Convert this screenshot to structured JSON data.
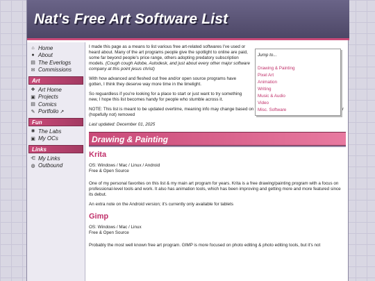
{
  "site": {
    "title": "Nat's Free Art Software List"
  },
  "sidebar": {
    "top": [
      {
        "icon": "⌂",
        "label": "Home"
      },
      {
        "icon": "●",
        "label": "About"
      },
      {
        "icon": "▤",
        "label": "The Everlogs"
      },
      {
        "icon": "✉",
        "label": "Commissions"
      }
    ],
    "art": {
      "heading": "Art",
      "items": [
        {
          "icon": "❖",
          "label": "Art Home"
        },
        {
          "icon": "▣",
          "label": "Projects"
        },
        {
          "icon": "▤",
          "label": "Comics"
        },
        {
          "icon": "✎",
          "label": "Portfolio",
          "ext": "↗"
        }
      ]
    },
    "fun": {
      "heading": "Fun",
      "items": [
        {
          "icon": "✺",
          "label": "The Labs"
        },
        {
          "icon": "▣",
          "label": "My OCs"
        }
      ]
    },
    "links": {
      "heading": "Links",
      "items": [
        {
          "icon": "⋲",
          "label": "My Links"
        },
        {
          "icon": "◍",
          "label": "Outbound"
        }
      ]
    }
  },
  "intro": {
    "p1": "I made this page as a means to list various free art-related softwares I've used or heard about. Many of the art programs people give the spotlight to online are paid, some far beyond people's price range, others adopting predatory subscription models.",
    "p1_aside": "(Cough cough Adobe, Autodesk, and just about every other major software company at this point jesus christ)",
    "p2": "With how advanced and fleshed out free and/or open source programs have gotten, I think they deserve way more time in the limelight.",
    "p3": "So reguardless if you're looking for a place to start or just want to try something new, I hope this list becomes handy for people who stumble across it.",
    "note": "NOTE: This list is meant to be updated overtime, meaning info may change based on updates & programs may be added, moved or (hopefully not) removed",
    "updated": "Last updated: December 01, 2025"
  },
  "jump": {
    "title": "Jump to...",
    "links": [
      "Drawing & Painting",
      "Pixel Art",
      "Animation",
      "Writing",
      "Music & Audio",
      "Video",
      "Misc. Software"
    ]
  },
  "section": {
    "title": "Drawing & Painting"
  },
  "programs": [
    {
      "name": "Krita",
      "os": "OS: Windows / Mac / Linux / Android",
      "license": "Free & Open Source",
      "desc": "One of my personal favorites on this list & my main art program for years. Krita is a free drawing/painting program with a focus on professional-level tools and work. It also has animation tools, which has been improving and getting more and more featured since its debut.",
      "extra": "An extra note on the Android version; it's currently only available for tablets"
    },
    {
      "name": "Gimp",
      "os": "OS: Windows / Mac / Linux",
      "license": "Free & Open Source",
      "desc": "Probably the most well known free art program. GIMP is more focused on photo editing & photo editing tools, but it's not",
      "extra": ""
    }
  ]
}
